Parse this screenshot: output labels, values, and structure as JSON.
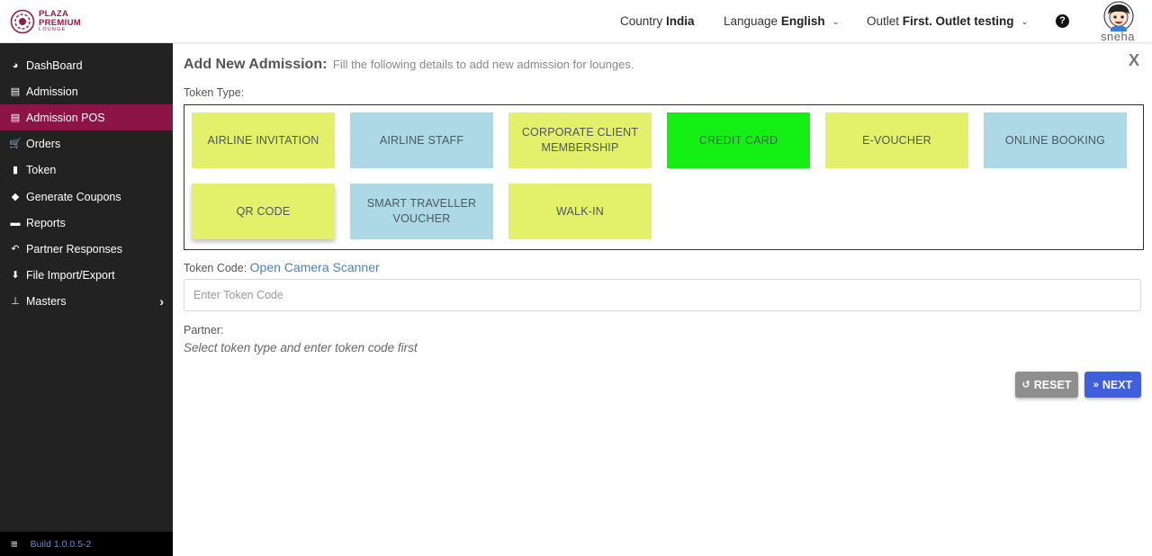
{
  "header": {
    "logo": {
      "line1": "PLAZA",
      "line2": "PREMIUM",
      "line3": "LOUNGE"
    },
    "country": {
      "label": "Country",
      "value": "India"
    },
    "language": {
      "label": "Language",
      "value": "English"
    },
    "outlet": {
      "label": "Outlet",
      "value": "First. Outlet testing"
    },
    "help_icon": "?",
    "user": {
      "name": "sneha"
    }
  },
  "sidebar": {
    "items": [
      {
        "label": "DashBoard",
        "icon": "dashboard-icon",
        "glyph": "◕"
      },
      {
        "label": "Admission",
        "icon": "id-card-icon",
        "glyph": "▤"
      },
      {
        "label": "Admission POS",
        "icon": "id-card-icon",
        "glyph": "▤",
        "active": true
      },
      {
        "label": "Orders",
        "icon": "cart-icon",
        "glyph": "🛒"
      },
      {
        "label": "Token",
        "icon": "file-icon",
        "glyph": "▮"
      },
      {
        "label": "Generate Coupons",
        "icon": "tag-icon",
        "glyph": "◆"
      },
      {
        "label": "Reports",
        "icon": "book-icon",
        "glyph": "▬"
      },
      {
        "label": "Partner Responses",
        "icon": "reply-icon",
        "glyph": "↶"
      },
      {
        "label": "File Import/Export",
        "icon": "download-icon",
        "glyph": "⬇"
      },
      {
        "label": "Masters",
        "icon": "sitemap-icon",
        "glyph": "⊥",
        "caret": "›"
      }
    ],
    "footer": {
      "menu_icon": "≡",
      "build": "Build 1.0.0.5-2"
    }
  },
  "main": {
    "title": "Add New Admission:",
    "subtitle": "Fill the following details to add new admission for lounges.",
    "close_label": "X",
    "token_type_label": "Token Type:",
    "token_types": [
      {
        "label": "AIRLINE INVITATION",
        "color": "#e3f06a"
      },
      {
        "label": "AIRLINE STAFF",
        "color": "#add8e6"
      },
      {
        "label": "CORPORATE CLIENT MEMBERSHIP",
        "color": "#e3f06a"
      },
      {
        "label": "CREDIT CARD",
        "color": "#14f014"
      },
      {
        "label": "E-VOUCHER",
        "color": "#e3f06a"
      },
      {
        "label": "ONLINE BOOKING",
        "color": "#add8e6"
      },
      {
        "label": "QR CODE",
        "color": "#e3f06a"
      },
      {
        "label": "SMART TRAVELLER VOUCHER",
        "color": "#add8e6"
      },
      {
        "label": "WALK-IN",
        "color": "#e3f06a"
      }
    ],
    "token_code_label": "Token Code:",
    "scanner_link": "Open Camera Scanner",
    "token_input_placeholder": "Enter Token Code",
    "token_input_value": "",
    "partner_label": "Partner:",
    "partner_note": "Select token type and enter token code first",
    "reset_label": "RESET",
    "next_label": "NEXT"
  },
  "colors": {
    "brand": "#8b1f45",
    "sidebar_bg": "#222222",
    "sidebar_active": "#8c1446",
    "reset_button": "#8e8e8e",
    "next_button": "#3f5fdc",
    "link": "#4a7fc1"
  }
}
